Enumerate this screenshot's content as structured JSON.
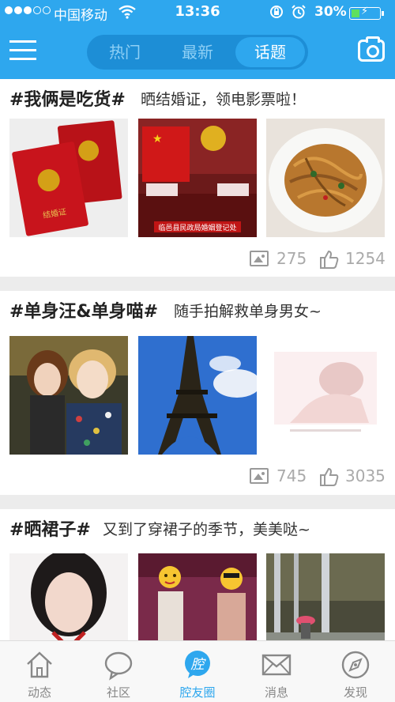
{
  "status_bar": {
    "carrier": "中国移动",
    "time": "13:36",
    "battery_percent_label": "30%",
    "battery_level": 0.3
  },
  "nav": {
    "tabs": [
      {
        "label": "热门"
      },
      {
        "label": "最新"
      },
      {
        "label": "话题"
      }
    ],
    "active_tab": "话题"
  },
  "topics": [
    {
      "title": "#我俩是吃货#",
      "description": "晒结婚证，领电影票啦！",
      "image_count": "275",
      "like_count": "1254",
      "images": [
        {
          "desc": "结婚证",
          "image_text": "结婚证"
        },
        {
          "desc": "婚姻登记处",
          "image_text": "临邑县民政局婚姻登记处"
        },
        {
          "desc": "面条"
        }
      ]
    },
    {
      "title": "#单身汪&单身喵#",
      "description": "随手拍解救单身男女~",
      "image_count": "745",
      "like_count": "3035",
      "images": [
        {
          "desc": "自拍"
        },
        {
          "desc": "埃菲尔铁塔"
        },
        {
          "desc": "插画"
        }
      ]
    },
    {
      "title": "#晒裙子#",
      "description": "又到了穿裙子的季节，美美哒~",
      "images": [
        {
          "desc": "自拍"
        },
        {
          "desc": "合照"
        },
        {
          "desc": "瀑布"
        }
      ]
    }
  ],
  "tab_bar": {
    "items": [
      {
        "label": "动态",
        "icon": "home-icon"
      },
      {
        "label": "社区",
        "icon": "chat-bubble-icon"
      },
      {
        "label": "腔友圈",
        "icon": "qiang-badge-icon",
        "badge_text": "腔"
      },
      {
        "label": "消息",
        "icon": "envelope-icon"
      },
      {
        "label": "发现",
        "icon": "compass-icon"
      }
    ],
    "active_index": 2
  },
  "colors": {
    "accent": "#2ea7ee",
    "inactive": "#888888"
  }
}
